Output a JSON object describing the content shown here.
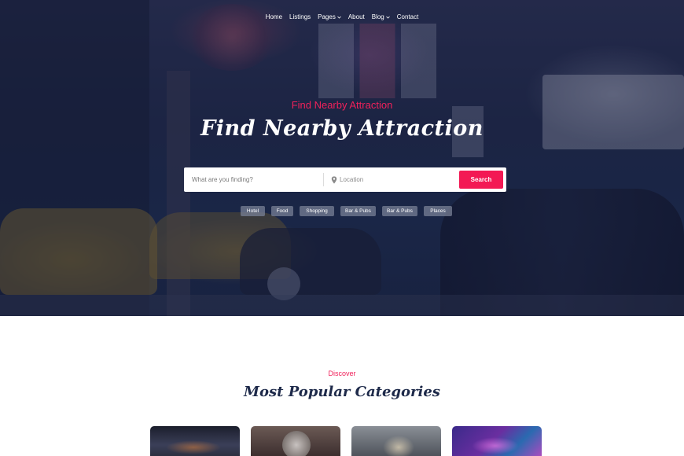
{
  "nav": {
    "items": [
      {
        "label": "Home",
        "has_dropdown": false
      },
      {
        "label": "Listings",
        "has_dropdown": false
      },
      {
        "label": "Pages",
        "has_dropdown": true
      },
      {
        "label": "About",
        "has_dropdown": false
      },
      {
        "label": "Blog",
        "has_dropdown": true
      },
      {
        "label": "Contact",
        "has_dropdown": false
      }
    ]
  },
  "hero": {
    "eyebrow": "Find Nearby Attraction",
    "title": "Find Nearby Attraction",
    "search": {
      "what_placeholder": "What are you finding?",
      "location_placeholder": "Location",
      "button_label": "Search"
    },
    "tags": [
      "Hotel",
      "Food",
      "Shopping",
      "Bar & Pubs",
      "Bar & Pubs",
      "Places"
    ]
  },
  "categories": {
    "eyebrow": "Discover",
    "title": "Most Popular Categories"
  },
  "colors": {
    "accent": "#f31954",
    "heading": "#1e2a4a",
    "hero_overlay": "#162042",
    "tag_bg": "#787f96"
  },
  "icons": {
    "location": "map-pin-icon",
    "dropdown": "chevron-down-icon"
  }
}
